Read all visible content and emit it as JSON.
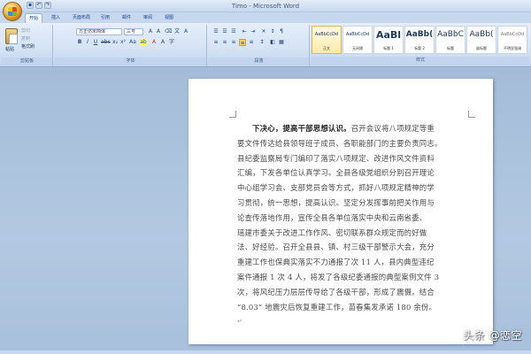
{
  "window": {
    "title": "Timo - Microsoft Word",
    "quick_access": [
      "save-icon",
      "undo-icon",
      "redo-icon"
    ]
  },
  "tabs": [
    "开始",
    "插入",
    "页面布局",
    "引用",
    "邮件",
    "审阅",
    "视图"
  ],
  "ribbon": {
    "clipboard": {
      "paste_label": "粘贴",
      "cut_label": "剪切",
      "copy_label": "复制",
      "format_painter_label": "格式刷",
      "group_label": "剪贴板"
    },
    "font": {
      "font_name": "方正仿宋简体",
      "font_size": "三号",
      "group_label": "字体"
    },
    "paragraph": {
      "group_label": "段落"
    },
    "styles": {
      "group_label": "样式",
      "items": [
        {
          "sample": "AaBbCcDd",
          "name": "正文"
        },
        {
          "sample": "AaBbCcDd",
          "name": "无间隔"
        },
        {
          "sample": "AaBl",
          "name": "标题 1"
        },
        {
          "sample": "AaBb(",
          "name": "标题 2"
        },
        {
          "sample": "AaBbC",
          "name": "标题"
        },
        {
          "sample": "AaBb(",
          "name": "副标题"
        },
        {
          "sample": "AaBbCcDd",
          "name": "不明显强调"
        }
      ]
    }
  },
  "document": {
    "heading": "下决心，提高干部思想认识。",
    "lines": [
      "召开会议将八项规定等重",
      "要文件传达给县领导班子成员、各职能部门的主要负责同志。",
      "县纪委监察局专门编印了落实八项规定、改进作风文件资料",
      "汇编，下发各单位认真学习。全县各级党组织分别召开理论",
      "中心组学习会、支部党员会等方式，抓好八项规定精神的学",
      "习贯彻，统一思想，提高认识。坚定分发挥事前把关作用与",
      "论查传落地作用，宣传全县各单位落实中央和云南省委、",
      "瑶建市委关于改进工作作风、密切联系群众规定而的好做",
      "法、好经验。召开全县县、镇、村三级干部警示大会，充分",
      "重建工作也保典实落实不力通报了次 11 人，县内典型违纪",
      "案件通报 1 次 4 人，将发了各级纪委通报的典型案例文件 3",
      "次，将风纪压力层层传导给了各级干部，形成了震慑。结合",
      "“8.03” 地震灾后恢复重建工作，苗春集发承诺 180 余份。"
    ]
  },
  "watermark": "头条 @恋空"
}
